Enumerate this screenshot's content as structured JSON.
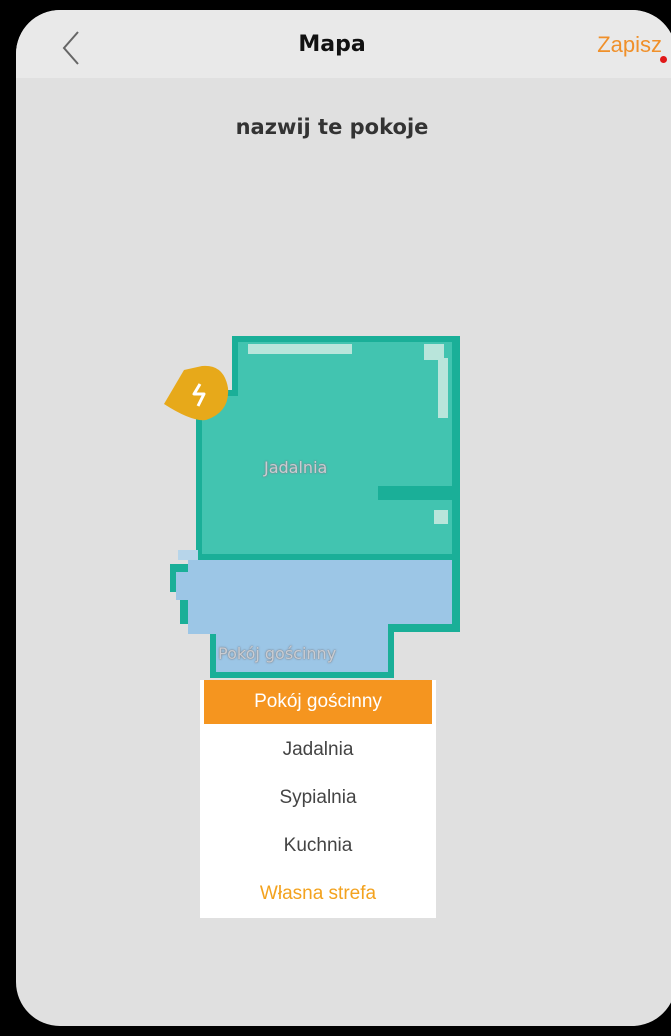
{
  "header": {
    "title": "Mapa",
    "save_label": "Zapisz"
  },
  "subtitle": "nazwij te pokoje",
  "map": {
    "rooms": [
      {
        "name": "Jadalnia",
        "color": "#42c4b0"
      },
      {
        "name": "Pokój gościnny",
        "color": "#9cc6e6"
      }
    ],
    "wall_color": "#1aaf98",
    "charger_icon": "charging-dock-icon",
    "charger_color": "#e7a91a"
  },
  "dropdown": {
    "options": [
      "Pokój gościnny",
      "Jadalnia",
      "Sypialnia",
      "Kuchnia",
      "Własna strefa"
    ],
    "selected": "Pokój gościnny",
    "selected_color": "#f5951f",
    "custom_color": "#f3a21e"
  },
  "colors": {
    "accent": "#f0902a",
    "notification_dot": "#e01818"
  }
}
